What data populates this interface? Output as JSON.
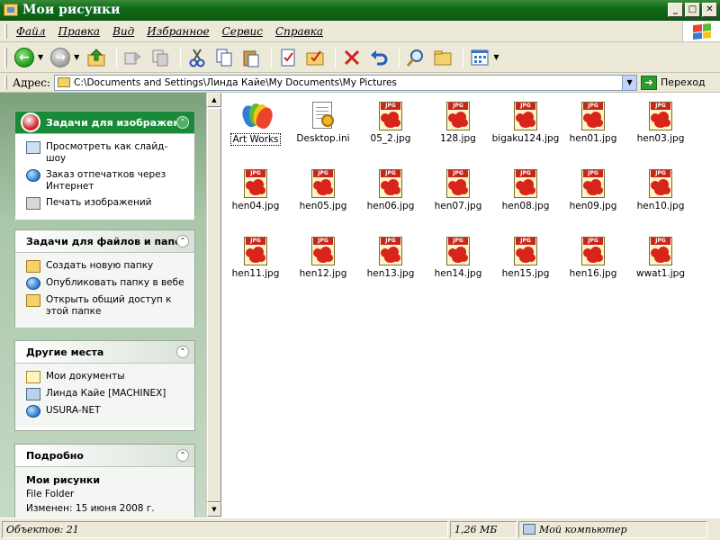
{
  "window": {
    "title": "Мои рисунки",
    "buttons": {
      "minimize": "_",
      "maximize": "□",
      "close": "✕"
    }
  },
  "menu": {
    "items": [
      "Файл",
      "Правка",
      "Вид",
      "Избранное",
      "Сервис",
      "Справка"
    ]
  },
  "toolbar": {
    "icons": [
      "back-icon",
      "forward-icon",
      "up-folder-icon",
      "move-icon",
      "copy-to-icon",
      "cut-icon",
      "copy-icon",
      "paste-icon",
      "properties-icon",
      "folder-check-icon",
      "delete-icon",
      "undo-icon",
      "search-icon",
      "folders-icon",
      "views-icon"
    ]
  },
  "address": {
    "label": "Адрес:",
    "path": "C:\\Documents and Settings\\Линда Кайе\\My Documents\\My Pictures",
    "go_label": "Переход"
  },
  "taskpane": {
    "image_tasks": {
      "title": "Задачи для изображен",
      "items": [
        "Просмотреть как слайд-шоу",
        "Заказ отпечатков через Интернет",
        "Печать изображений"
      ]
    },
    "file_tasks": {
      "title": "Задачи для файлов и папок",
      "items": [
        "Создать новую папку",
        "Опубликовать папку в вебе",
        "Открыть общий доступ к этой папке"
      ]
    },
    "other_places": {
      "title": "Другие места",
      "items": [
        "Мои документы",
        "Линда Кайе [MACHINEX]",
        "USURA-NET"
      ]
    },
    "details": {
      "title": "Подробно",
      "name": "Мои рисунки",
      "type": "File Folder",
      "modified": "Изменен: 15 июня 2008 г."
    }
  },
  "files": [
    {
      "name": "Art Works",
      "kind": "msn"
    },
    {
      "name": "Desktop.ini",
      "kind": "ini"
    },
    {
      "name": "05_2.jpg",
      "kind": "jpg"
    },
    {
      "name": "128.jpg",
      "kind": "jpg"
    },
    {
      "name": "bigaku124.jpg",
      "kind": "jpg"
    },
    {
      "name": "hen01.jpg",
      "kind": "jpg"
    },
    {
      "name": "hen03.jpg",
      "kind": "jpg"
    },
    {
      "name": "hen04.jpg",
      "kind": "jpg"
    },
    {
      "name": "hen05.jpg",
      "kind": "jpg"
    },
    {
      "name": "hen06.jpg",
      "kind": "jpg"
    },
    {
      "name": "hen07.jpg",
      "kind": "jpg"
    },
    {
      "name": "hen08.jpg",
      "kind": "jpg"
    },
    {
      "name": "hen09.jpg",
      "kind": "jpg"
    },
    {
      "name": "hen10.jpg",
      "kind": "jpg"
    },
    {
      "name": "hen11.jpg",
      "kind": "jpg"
    },
    {
      "name": "hen12.jpg",
      "kind": "jpg"
    },
    {
      "name": "hen13.jpg",
      "kind": "jpg"
    },
    {
      "name": "hen14.jpg",
      "kind": "jpg"
    },
    {
      "name": "hen15.jpg",
      "kind": "jpg"
    },
    {
      "name": "hen16.jpg",
      "kind": "jpg"
    },
    {
      "name": "wwat1.jpg",
      "kind": "jpg"
    }
  ],
  "file_icon_tag": "JPG",
  "status": {
    "objects": "Объектов: 21",
    "size": "1,26 МБ",
    "location": "Мой компьютер"
  },
  "colors": {
    "titlebar": "#0f6b17",
    "taskpane_primary": "#1a8a3a",
    "jpg_red": "#d8241a"
  }
}
